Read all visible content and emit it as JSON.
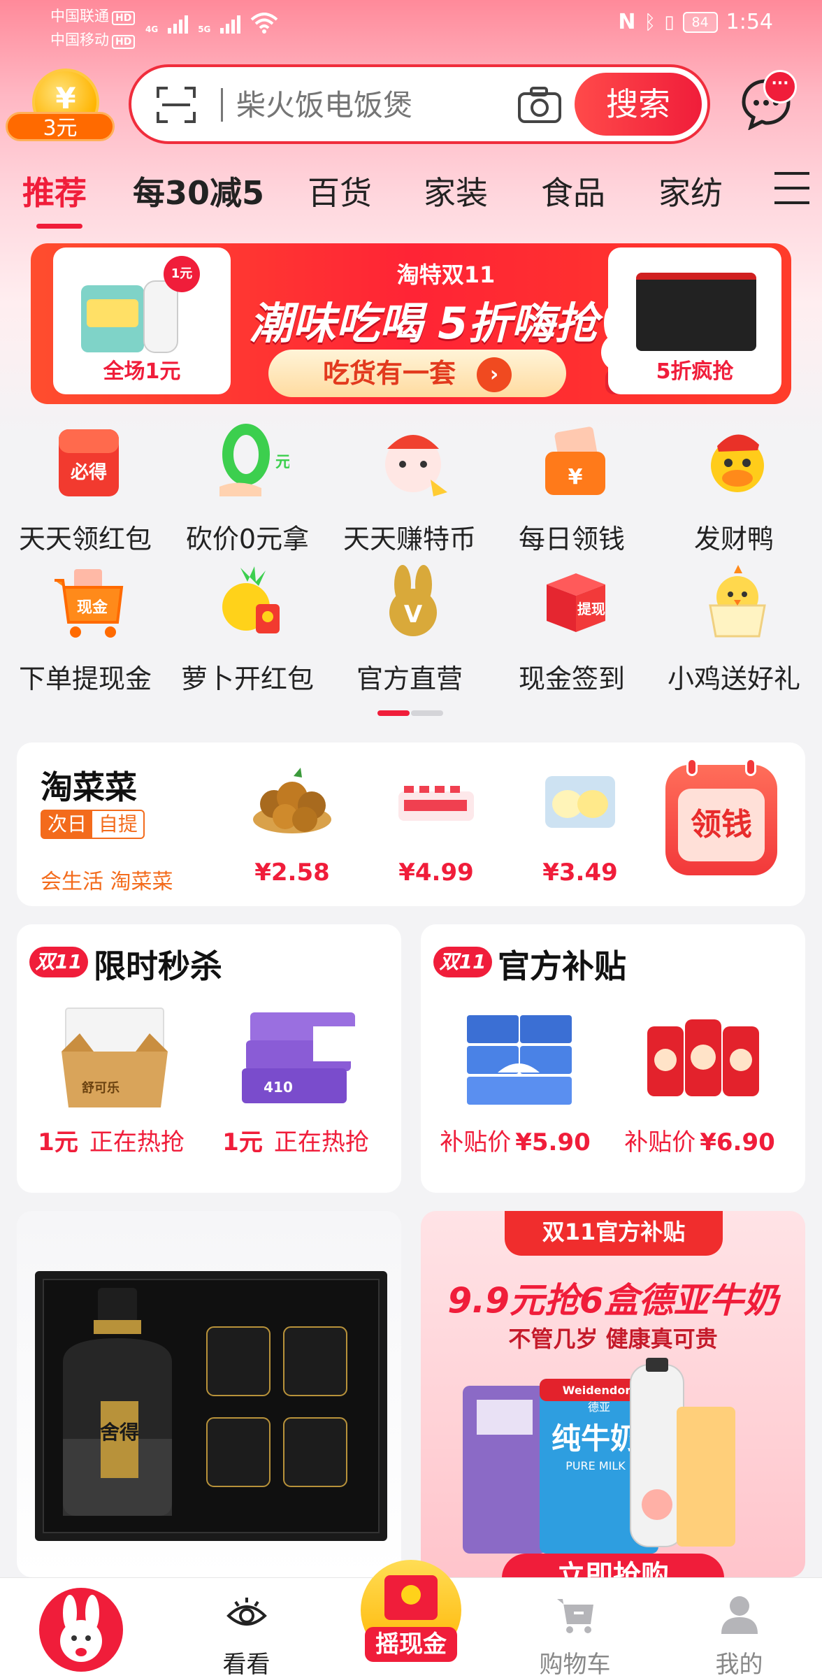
{
  "status_bar": {
    "carrier_1": "中国联通",
    "carrier_2": "中国移动",
    "hd": "HD",
    "net_1": "4G",
    "net_2": "5G",
    "battery": "84",
    "time": "1:54"
  },
  "coin": {
    "symbol": "¥",
    "amount": "3元"
  },
  "search": {
    "placeholder": "柴火饭电饭煲",
    "button": "搜索",
    "message_dot": "···"
  },
  "tabs": [
    "推荐",
    "每30减5",
    "百货",
    "家装",
    "食品",
    "家纺"
  ],
  "banner": {
    "tag": "淘特双11",
    "headline": "潮味吃喝 5折嗨抢",
    "cta": "吃货有一套",
    "left_badge": "1元",
    "left_label": "全场1元",
    "right_label": "5折疯抢"
  },
  "icon_grid": [
    {
      "label": "天天领红包",
      "icon": "red-envelope-icon",
      "badge": "必得"
    },
    {
      "label": "砍价0元拿",
      "icon": "zero-yuan-icon",
      "badge": "元"
    },
    {
      "label": "天天赚特币",
      "icon": "cat-mascot-icon",
      "badge": ""
    },
    {
      "label": "每日领钱",
      "icon": "wallet-icon",
      "badge": "¥"
    },
    {
      "label": "发财鸭",
      "icon": "duck-icon",
      "badge": ""
    },
    {
      "label": "下单提现金",
      "icon": "cart-cash-icon",
      "badge": "现金"
    },
    {
      "label": "萝卜开红包",
      "icon": "radish-icon",
      "badge": ""
    },
    {
      "label": "官方直营",
      "icon": "rabbit-v-icon",
      "badge": "V"
    },
    {
      "label": "现金签到",
      "icon": "cash-box-icon",
      "badge": "提现"
    },
    {
      "label": "小鸡送好礼",
      "icon": "chick-icon",
      "badge": ""
    }
  ],
  "taocaicai": {
    "title": "淘菜菜",
    "badge_a": "次日",
    "badge_b": "自提",
    "subtitle": "会生活 淘菜菜",
    "products": [
      {
        "price": "¥2.58",
        "image": "jujube"
      },
      {
        "price": "¥4.99",
        "image": "yogurt-drink"
      },
      {
        "price": "¥3.49",
        "image": "bread"
      }
    ],
    "claim_button": "领钱"
  },
  "flash_sale": {
    "badge": "双11",
    "title": "限时秒杀",
    "items": [
      {
        "price": "1元",
        "status": "正在热抢",
        "image": "tissue-box",
        "brand": "舒可乐"
      },
      {
        "price": "1元",
        "status": "正在热抢",
        "image": "tissue-pack",
        "count": "410"
      }
    ]
  },
  "subsidy": {
    "badge": "双11",
    "title": "官方补贴",
    "items": [
      {
        "label": "补贴价",
        "price": "¥5.90",
        "image": "tissue"
      },
      {
        "label": "补贴价",
        "price": "¥6.90",
        "image": "milk-cans"
      }
    ]
  },
  "liquor": {
    "brand": "舍得"
  },
  "promo_card": {
    "top": "双11官方补贴",
    "headline": "9.9元抢6盒德亚牛奶",
    "subline": "不管几岁 健康真可贵",
    "cta": "立即抢购",
    "brand": "Weidendorf",
    "brand_cn": "德亚",
    "product": "纯牛奶",
    "product_en": "PURE MILK"
  },
  "bottom_nav": [
    {
      "label": "",
      "icon": "rabbit-home-icon"
    },
    {
      "label": "看看",
      "icon": "eye-icon"
    },
    {
      "label": "摇现金",
      "icon": "cash-envelope-icon"
    },
    {
      "label": "购物车",
      "icon": "cart-icon"
    },
    {
      "label": "我的",
      "icon": "profile-icon"
    }
  ],
  "colors": {
    "accent": "#f01d3a",
    "orange": "#f36b1c",
    "gold": "#ffb400"
  }
}
